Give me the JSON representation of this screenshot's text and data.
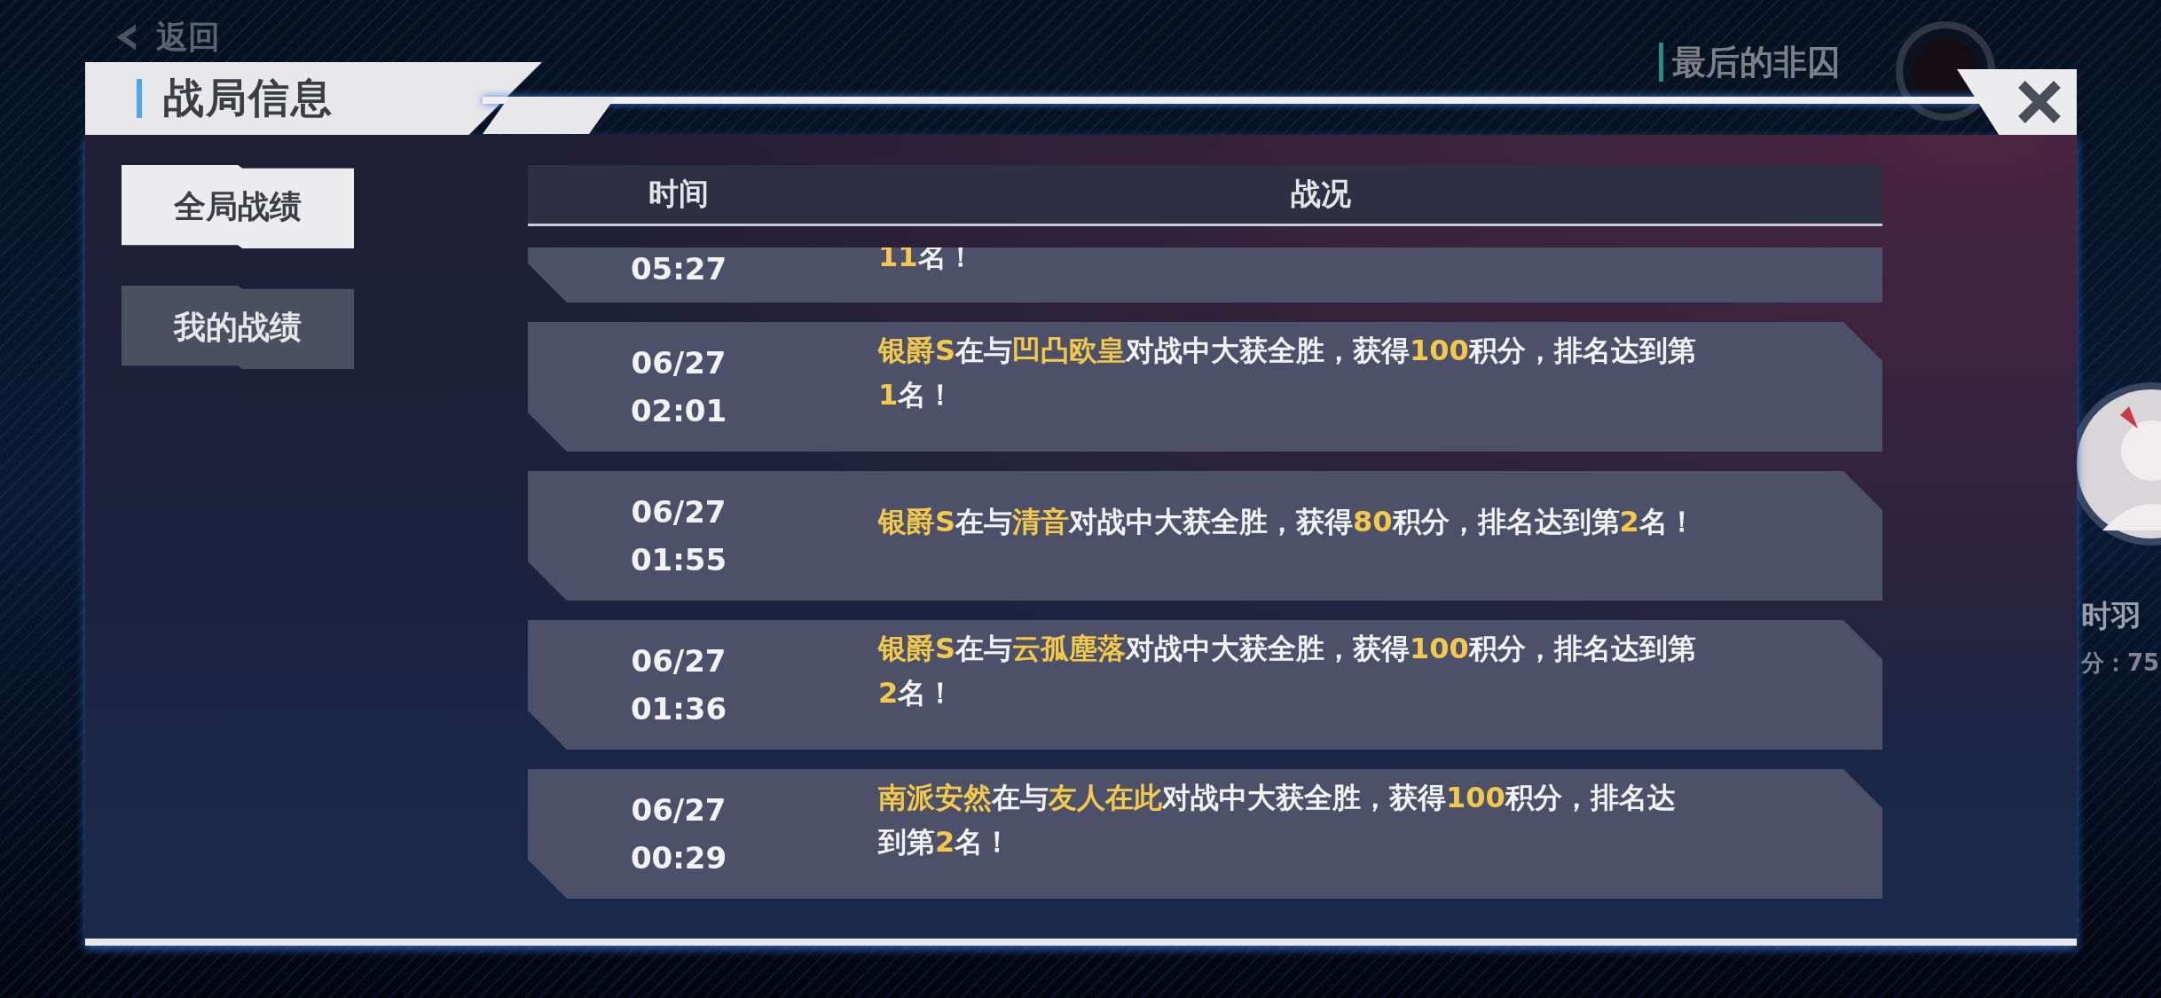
{
  "background": {
    "back_button": {
      "label": "返回"
    },
    "player_title": "最后的非囚",
    "side_player": {
      "name": "时羽",
      "score": "分：75"
    }
  },
  "dialog": {
    "title": "战局信息",
    "tabs": [
      {
        "label": "全局战绩",
        "selected": true
      },
      {
        "label": "我的战绩",
        "selected": false
      }
    ],
    "table": {
      "columns": [
        "时间",
        "战况"
      ],
      "rows": [
        {
          "partial": true,
          "time": "05:27",
          "segments": [
            {
              "text": "11",
              "highlight": true
            },
            {
              "text": "名！",
              "highlight": false
            }
          ]
        },
        {
          "partial": false,
          "date": "06/27",
          "time": "02:01",
          "segments": [
            {
              "text": "银爵S",
              "highlight": true
            },
            {
              "text": "在与",
              "highlight": false
            },
            {
              "text": "凹凸欧皇",
              "highlight": true
            },
            {
              "text": "对战中大获全胜，获得",
              "highlight": false
            },
            {
              "text": "100",
              "highlight": true
            },
            {
              "text": "积分，排名达到第",
              "highlight": false
            },
            {
              "text": "1",
              "highlight": true
            },
            {
              "text": "名！",
              "highlight": false
            }
          ]
        },
        {
          "partial": false,
          "date": "06/27",
          "time": "01:55",
          "segments": [
            {
              "text": "银爵S",
              "highlight": true
            },
            {
              "text": "在与",
              "highlight": false
            },
            {
              "text": "清音",
              "highlight": true
            },
            {
              "text": "对战中大获全胜，获得",
              "highlight": false
            },
            {
              "text": "80",
              "highlight": true
            },
            {
              "text": "积分，排名达到第",
              "highlight": false
            },
            {
              "text": "2",
              "highlight": true
            },
            {
              "text": "名！",
              "highlight": false
            }
          ]
        },
        {
          "partial": false,
          "date": "06/27",
          "time": "01:36",
          "segments": [
            {
              "text": "银爵S",
              "highlight": true
            },
            {
              "text": "在与",
              "highlight": false
            },
            {
              "text": "云孤塵落",
              "highlight": true
            },
            {
              "text": "对战中大获全胜，获得",
              "highlight": false
            },
            {
              "text": "100",
              "highlight": true
            },
            {
              "text": "积分，排名达到第",
              "highlight": false
            },
            {
              "text": "2",
              "highlight": true
            },
            {
              "text": "名！",
              "highlight": false
            }
          ]
        },
        {
          "partial": false,
          "date": "06/27",
          "time": "00:29",
          "segments": [
            {
              "text": "南派安然",
              "highlight": true
            },
            {
              "text": "在与",
              "highlight": false
            },
            {
              "text": "友人在此",
              "highlight": true
            },
            {
              "text": "对战中大获全胜，获得",
              "highlight": false
            },
            {
              "text": "100",
              "highlight": true
            },
            {
              "text": "积分，排名达",
              "highlight": false
            },
            {
              "text": "到第",
              "highlight": false
            },
            {
              "text": "2",
              "highlight": true
            },
            {
              "text": "名！",
              "highlight": false
            }
          ]
        }
      ]
    }
  }
}
